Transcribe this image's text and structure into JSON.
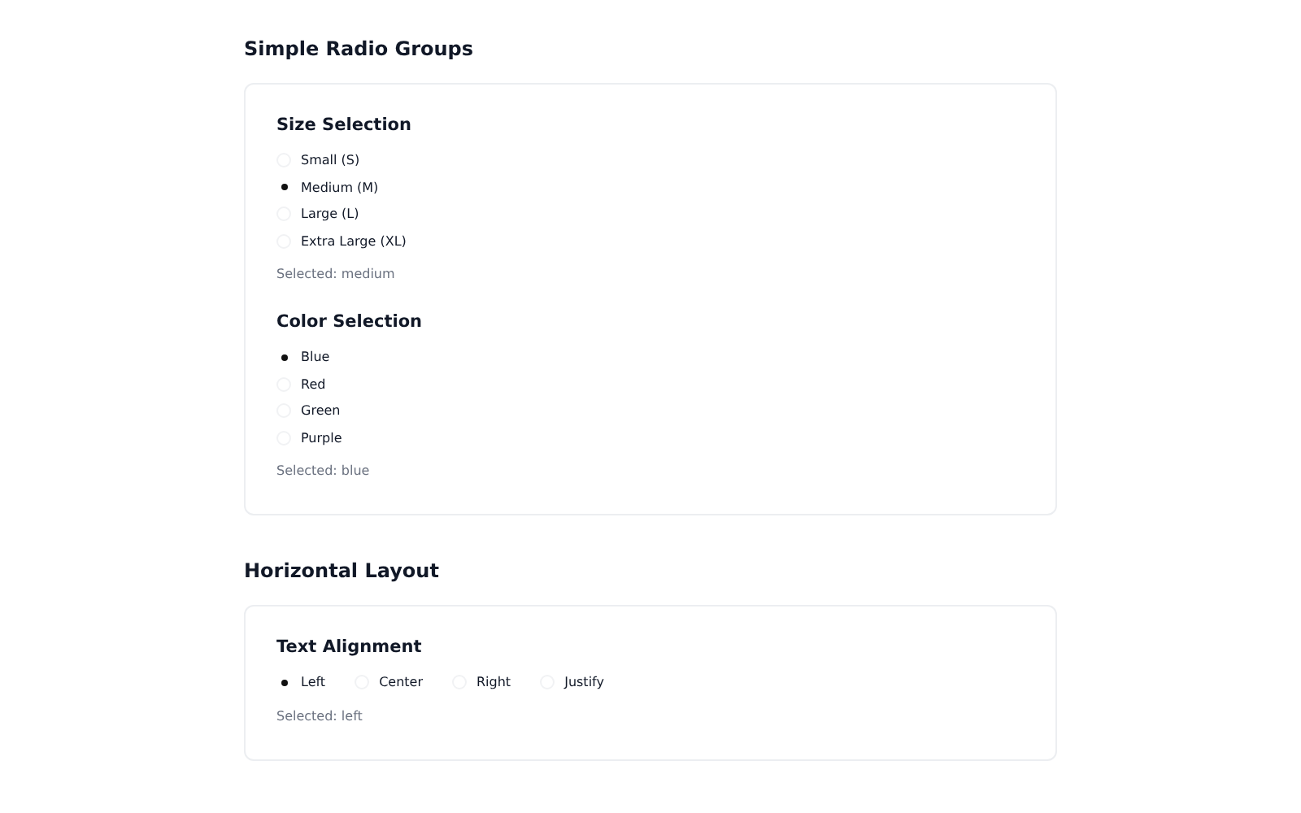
{
  "sections": [
    {
      "title": "Simple Radio Groups",
      "groups": [
        {
          "title": "Size Selection",
          "kind": "vertical",
          "options": [
            {
              "label": "Small (S)",
              "selected": false
            },
            {
              "label": "Medium (M)",
              "selected": true
            },
            {
              "label": "Large (L)",
              "selected": false
            },
            {
              "label": "Extra Large (XL)",
              "selected": false
            }
          ],
          "status": "Selected: medium"
        },
        {
          "title": "Color Selection",
          "kind": "vertical",
          "options": [
            {
              "label": "Blue",
              "selected": true
            },
            {
              "label": "Red",
              "selected": false
            },
            {
              "label": "Green",
              "selected": false
            },
            {
              "label": "Purple",
              "selected": false
            }
          ],
          "status": "Selected: blue"
        }
      ]
    },
    {
      "title": "Horizontal Layout",
      "groups": [
        {
          "title": "Text Alignment",
          "kind": "horizontal",
          "options": [
            {
              "label": "Left",
              "selected": true
            },
            {
              "label": "Center",
              "selected": false
            },
            {
              "label": "Right",
              "selected": false
            },
            {
              "label": "Justify",
              "selected": false
            }
          ],
          "status": "Selected: left"
        }
      ]
    }
  ]
}
